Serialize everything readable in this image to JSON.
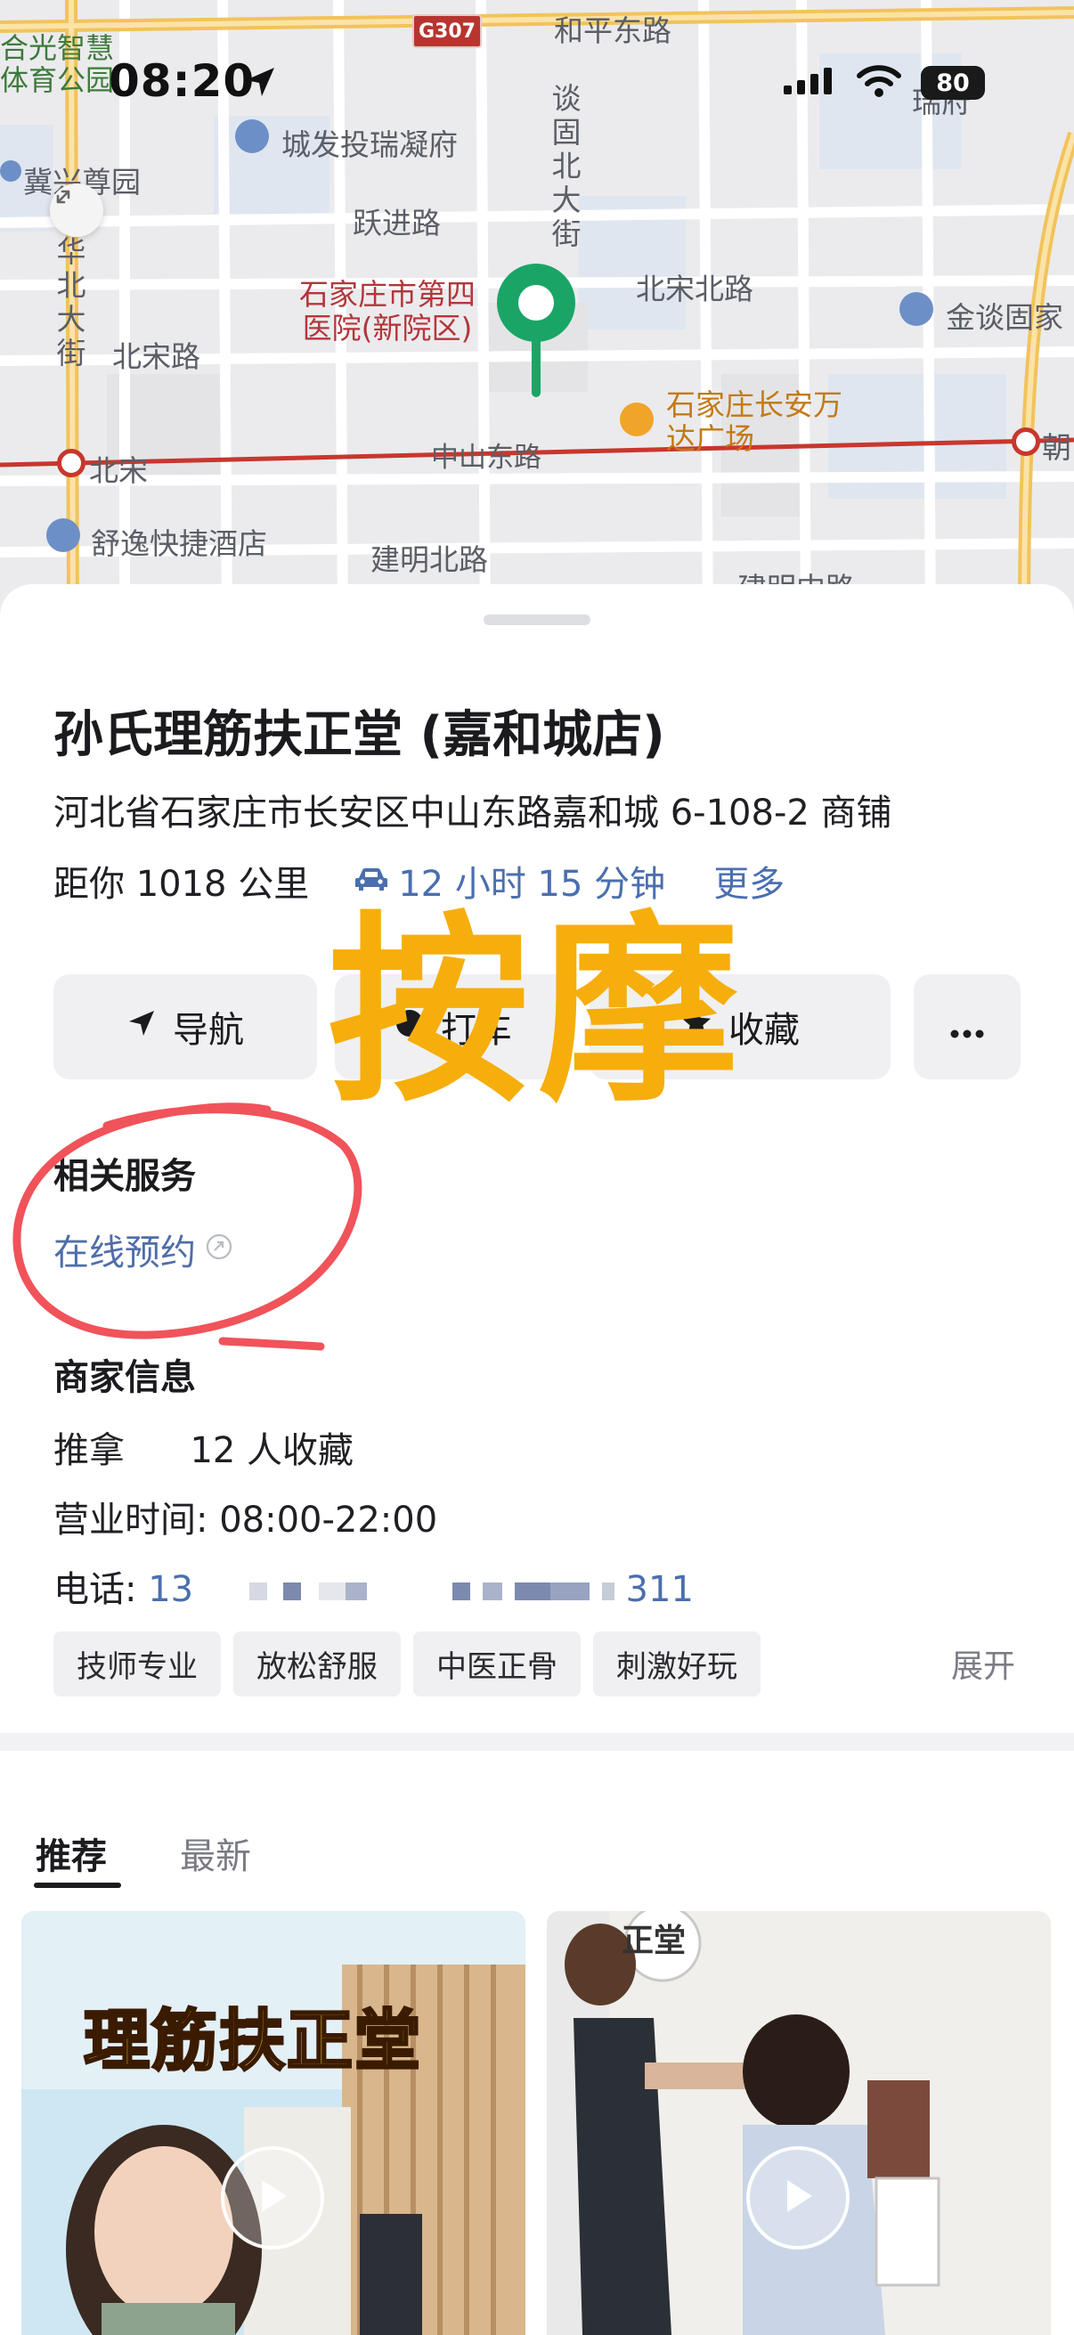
{
  "status_bar": {
    "time": "08:20",
    "battery": "80"
  },
  "map": {
    "labels": {
      "road_top": "和平东路",
      "park": "合光智慧体育公园",
      "road_g307": "G307",
      "residence": "城发投瑞凝府",
      "garden": "冀兴尊园",
      "yuejin": "跃进路",
      "tangu": "谈固北大街",
      "huabei": "华北大街",
      "beisong_road1": "北宋北路",
      "beisong_road2": "北宋路",
      "hospital": "石家庄市第四医院(新院区)",
      "jintan": "金谈固家",
      "wanda": "石家庄长安万达广场",
      "zhongshan": "中山东路",
      "metro_beisong": "北宋",
      "metro_right": "朝",
      "hotel": "舒逸快捷酒店",
      "jianming": "建明北路",
      "jianming2": "建明中路",
      "fu": "瑞府"
    }
  },
  "place": {
    "title": "孙氏理筋扶正堂 (嘉和城店)",
    "address": "河北省石家庄市长安区中山东路嘉和城 6-108-2 商铺",
    "distance": "距你 1018 公里",
    "drive_time": "12 小时 15 分钟",
    "more": "更多"
  },
  "actions": {
    "navigate": "导航",
    "taxi": "打车",
    "favorite": "收藏",
    "more_icon": "more-dots-icon"
  },
  "overlay_text": "按摩",
  "services": {
    "heading": "相关服务",
    "online_booking": "在线预约"
  },
  "merchant": {
    "heading": "商家信息",
    "category": "推拿",
    "favorites": "12 人收藏",
    "hours_label": "营业时间:",
    "hours": "08:00-22:00",
    "phone_label": "电话:",
    "phone_prefix": "13",
    "phone_suffix": "311",
    "tags": [
      "技师专业",
      "放松舒服",
      "中医正骨",
      "刺激好玩"
    ],
    "expand": "展开"
  },
  "feed": {
    "tabs": [
      "推荐",
      "最新"
    ],
    "card1_title": "理筋扶正堂",
    "card2_sign": "正堂"
  },
  "colors": {
    "accent_blue": "#4b6fae",
    "overlay_orange": "#f6ae0c",
    "circle_red": "#f0535a",
    "pin_green": "#1aa566"
  }
}
